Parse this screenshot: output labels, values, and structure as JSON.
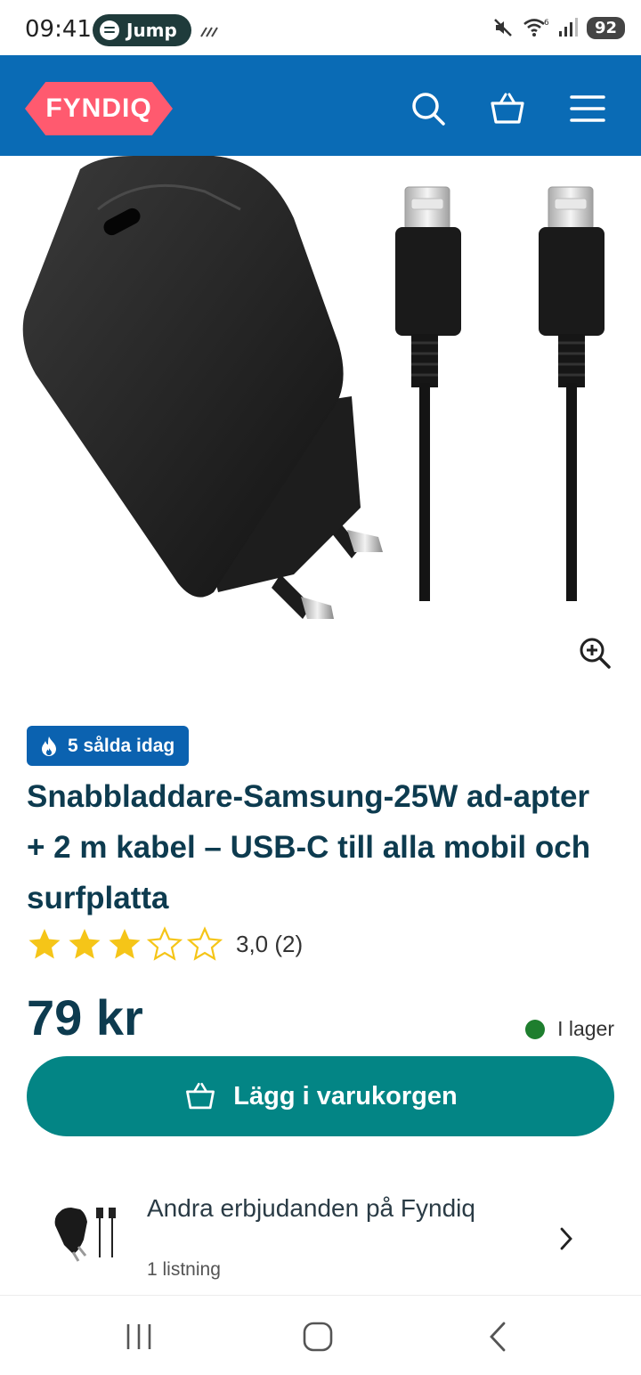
{
  "status_bar": {
    "time": "09:41",
    "spotify_label": "Jump",
    "battery": "92"
  },
  "header": {
    "logo_text": "FYNDIQ",
    "brand_color": "#0a6bb5",
    "logo_color": "#ff5a6f",
    "icons": [
      "search-icon",
      "cart-icon",
      "menu-icon"
    ]
  },
  "product": {
    "sold_badge": "5 sålda idag",
    "title": "Snabbladdare-Samsung-25W ad-apter + 2 m kabel – USB-C till alla mobil och surfplatta",
    "rating": {
      "value": 3.0,
      "text": "3,0 (2)",
      "stars_filled": 3,
      "stars_total": 5
    },
    "price": "79 kr",
    "stock": "I lager",
    "stock_color": "#1e7e2e",
    "add_to_cart": "Lägg i varukorgen",
    "button_color": "#038585"
  },
  "other_offers": {
    "title": "Andra erbjudanden på Fyndiq",
    "subtitle": "1 listning"
  }
}
